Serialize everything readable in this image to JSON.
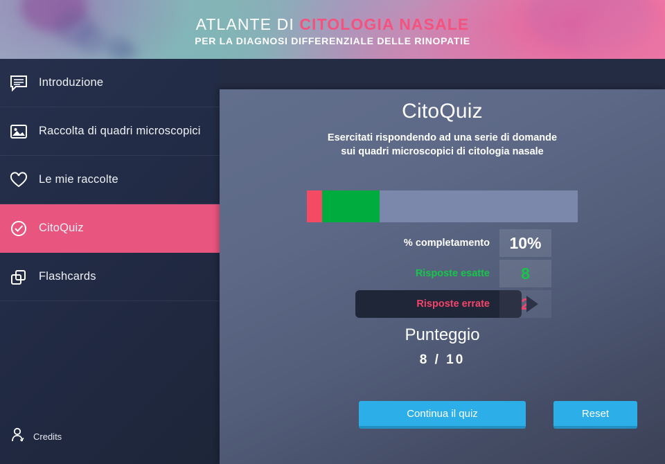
{
  "header": {
    "title_prefix": "ATLANTE DI ",
    "title_accent": "CITOLOGIA NASALE",
    "subtitle": "PER LA DIAGNOSI DIFFERENZIALE DELLE RINOPATIE",
    "accent_color": "#f4527f"
  },
  "sidebar": {
    "items": [
      {
        "label": "Introduzione",
        "icon": "comment-icon",
        "active": false
      },
      {
        "label": "Raccolta di quadri microscopici",
        "icon": "image-icon",
        "active": false
      },
      {
        "label": "Le mie raccolte",
        "icon": "heart-icon",
        "active": false
      },
      {
        "label": "CitoQuiz",
        "icon": "check-circle-icon",
        "active": true
      },
      {
        "label": "Flashcards",
        "icon": "cards-icon",
        "active": false
      }
    ],
    "active_color": "#e8557f",
    "credits": {
      "label": "Credits",
      "icon": "user-icon"
    }
  },
  "main": {
    "title": "CitoQuiz",
    "subtitle_line1": "Esercitati rispondendo ad una serie di domande",
    "subtitle_line2": "sui quadri microscopici di citologia nasale",
    "progress": {
      "wrong_percent": 5.6,
      "right_percent": 21.2,
      "remaining_percent": 73.2,
      "wrong_color": "#f54a63",
      "right_color": "#00ac3e",
      "track_color": "#7b88ab"
    },
    "stats": [
      {
        "label": "% completamento",
        "value": "10%",
        "state": "neutral"
      },
      {
        "label": "Risposte esatte",
        "value": "8",
        "state": "correct",
        "color": "#18c44a"
      },
      {
        "label": "Risposte errate",
        "value": "2",
        "state": "wrong",
        "color": "#f4446a",
        "highlighted": true
      }
    ],
    "score": {
      "title": "Punteggio",
      "value": "8 / 10"
    },
    "buttons": {
      "continue": "Continua il quiz",
      "reset": "Reset",
      "color": "#2cafe8"
    }
  }
}
